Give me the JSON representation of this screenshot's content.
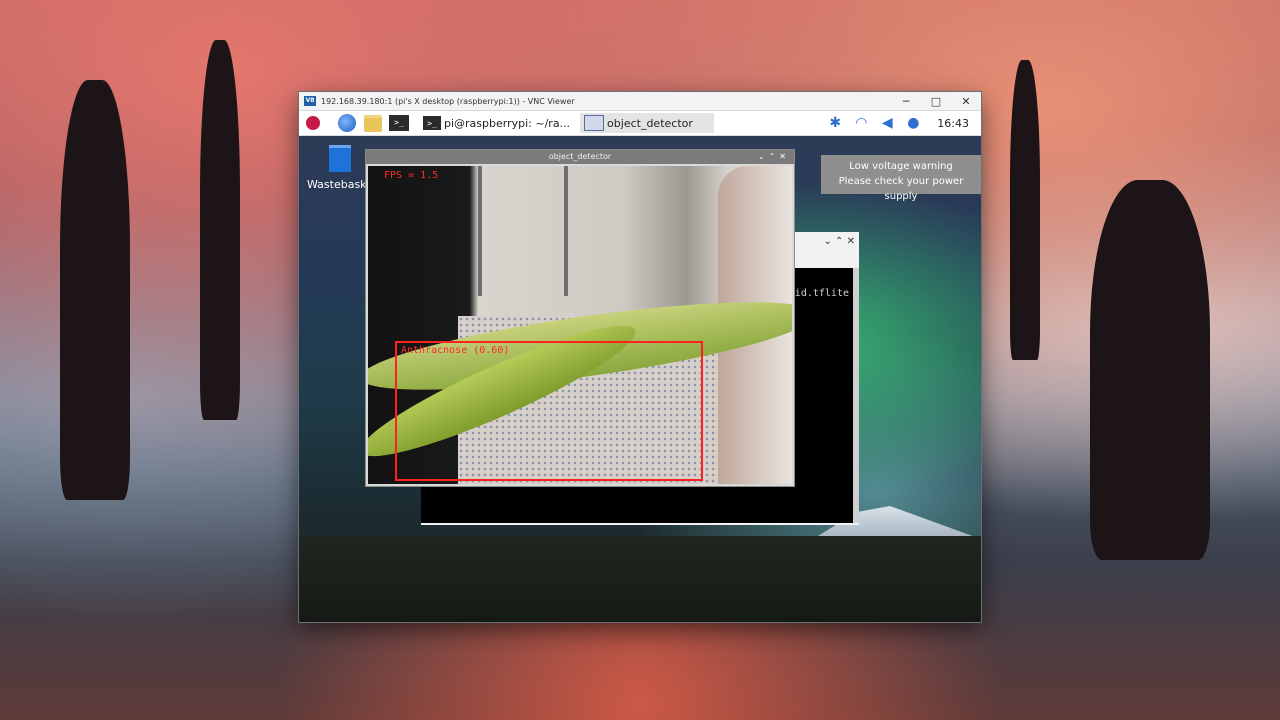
{
  "vnc": {
    "title": "192.168.39.180:1 (pi's X desktop (raspberrypi:1)) - VNC Viewer",
    "logo": "V8"
  },
  "taskbar": {
    "terminal_task": "pi@raspberrypi: ~/ra...",
    "detector_task": "object_detector",
    "clock": "16:43"
  },
  "notification": {
    "line1": "Low voltage warning",
    "line2": "Please check your power supply"
  },
  "desktop": {
    "wastebasket_label": "Wastebasket"
  },
  "terminal": {
    "visible_text": "oid.tflite"
  },
  "detector": {
    "window_title": "object_detector",
    "fps_text": "FPS = 1.5",
    "detection_label": "Anthracnose (0.60)"
  }
}
